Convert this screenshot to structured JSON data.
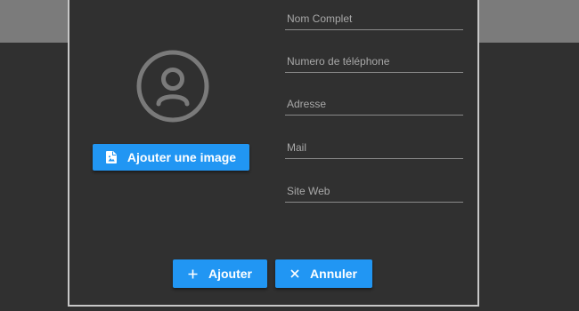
{
  "form": {
    "fields": [
      {
        "placeholder": "Nom Complet",
        "value": ""
      },
      {
        "placeholder": "Numero de téléphone",
        "value": ""
      },
      {
        "placeholder": "Adresse",
        "value": ""
      },
      {
        "placeholder": "Mail",
        "value": ""
      },
      {
        "placeholder": "Site Web",
        "value": ""
      }
    ]
  },
  "avatar": {
    "icon": "account-circle-icon"
  },
  "buttons": {
    "add_image": {
      "label": "Ajouter une image",
      "icon": "image-file-icon"
    },
    "ajouter": {
      "label": "Ajouter",
      "icon": "plus-icon"
    },
    "annuler": {
      "label": "Annuler",
      "icon": "close-icon"
    }
  },
  "colors": {
    "accent": "#2196f3",
    "background": "#303030",
    "top_band": "#7b7b7b",
    "dialog_border": "#c7c7c7"
  }
}
